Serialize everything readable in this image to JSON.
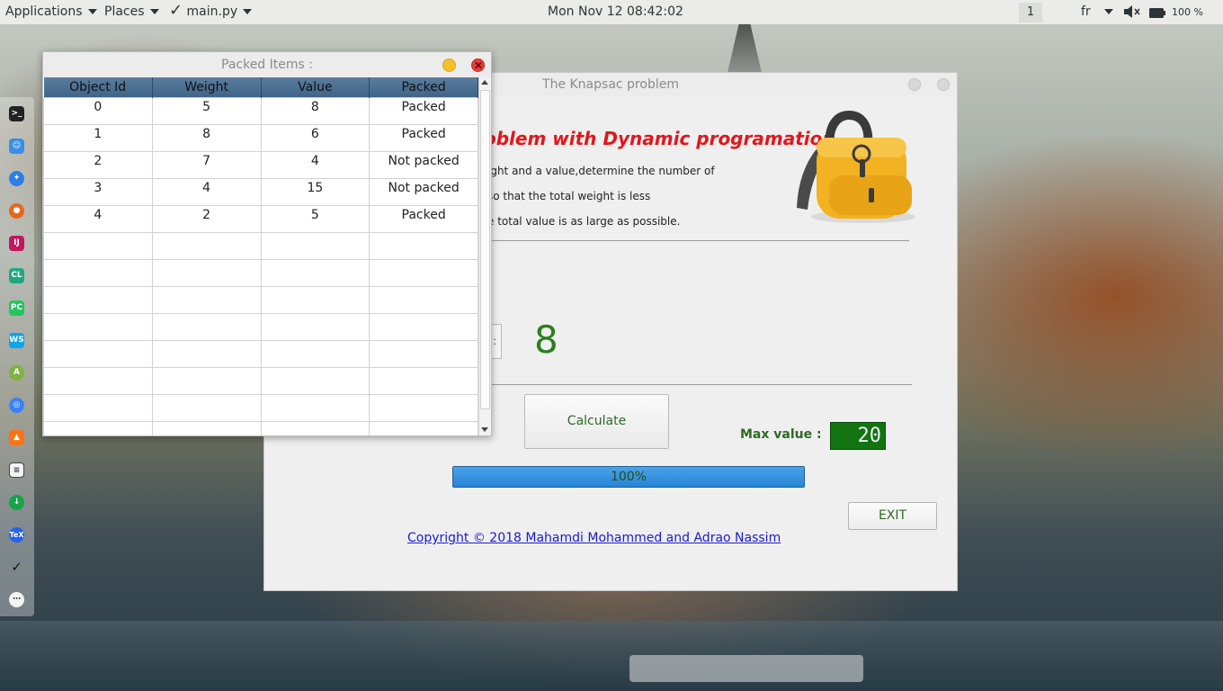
{
  "topbar": {
    "applications": "Applications",
    "places": "Places",
    "app_name": "main.py",
    "clock": "Mon Nov 12  08:42:02",
    "workspace": "1",
    "language": "fr",
    "battery": "100 %"
  },
  "dock": {
    "icons": [
      "terminal-icon",
      "finder-icon",
      "safari-icon",
      "firefox-icon",
      "intellij-icon",
      "clion-icon",
      "pycharm-icon",
      "webstorm-icon",
      "android-studio-icon",
      "network-icon",
      "vlc-icon",
      "text-editor-icon",
      "download-icon",
      "tex-icon",
      "check-icon",
      "apps-grid-icon"
    ]
  },
  "main_window": {
    "title": "The Knapsac problem",
    "heading": "oblem with Dynamic programation",
    "desc_lines": [
      "ight and a value,determine the number of",
      "so that the total weight is less",
      "e total value is as large as possible."
    ],
    "result_value": "8",
    "calculate_label": "Calculate",
    "max_value_label": "Max value :",
    "max_value": "20",
    "progress_text": "100%",
    "progress_value": 1.0,
    "exit_label": "EXIT",
    "copyright": "Copyright © 2018 Mahamdi Mohammed and Adrao Nassim",
    "spinner_text": ":"
  },
  "items_window": {
    "title": "Packed Items :",
    "columns": [
      "Object Id",
      "Weight",
      "Value",
      "Packed"
    ],
    "rows": [
      [
        "0",
        "5",
        "8",
        "Packed"
      ],
      [
        "1",
        "8",
        "6",
        "Packed"
      ],
      [
        "2",
        "7",
        "4",
        "Not packed"
      ],
      [
        "3",
        "4",
        "15",
        "Not packed"
      ],
      [
        "4",
        "2",
        "5",
        "Packed"
      ],
      [
        "",
        "",
        "",
        ""
      ],
      [
        "",
        "",
        "",
        ""
      ],
      [
        "",
        "",
        "",
        ""
      ],
      [
        "",
        "",
        "",
        ""
      ],
      [
        "",
        "",
        "",
        ""
      ],
      [
        "",
        "",
        "",
        ""
      ],
      [
        "",
        "",
        "",
        ""
      ],
      [
        "",
        "",
        "",
        ""
      ]
    ]
  },
  "colors": {
    "heading": "#e3161b",
    "accent_green": "#2e6a24",
    "lcd_bg": "#117411",
    "progress_fill": "#2884d6",
    "header_bg": "#3f6487"
  }
}
